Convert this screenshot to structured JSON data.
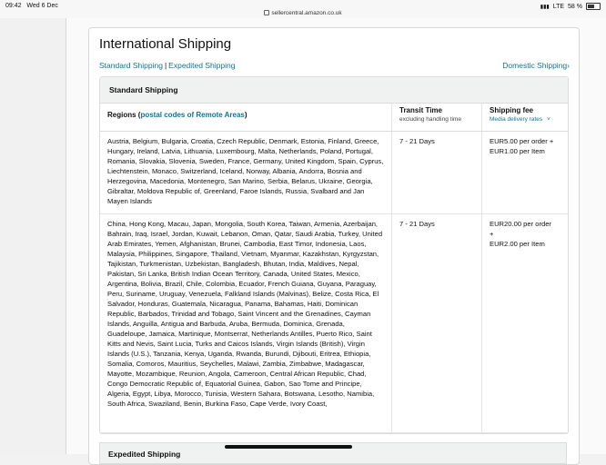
{
  "status_bar": {
    "time": "09:42",
    "date": "Wed 6 Dec",
    "url": "sellercentral.amazon.co.uk",
    "network": "LTE",
    "battery": "58 %",
    "battery_level": 0.58
  },
  "page": {
    "title": "International Shipping",
    "nav": {
      "standard_link": "Standard Shipping",
      "separator": "|",
      "expedited_link": "Expedited Shipping",
      "domestic_link": "Domestic Shipping",
      "domestic_chevron": "›"
    }
  },
  "standard_section": {
    "header": "Standard Shipping",
    "columns": {
      "regions": "Regions",
      "regions_link": "postal codes of Remote Areas",
      "transit": "Transit Time",
      "transit_sub": "excluding handling time",
      "fee": "Shipping fee",
      "fee_sub": "Media delivery rates",
      "fee_chevron": "˅"
    },
    "rows": [
      {
        "regions": "Austria, Belgium, Bulgaria, Croatia, Czech Republic, Denmark, Estonia, Finland, Greece, Hungary, Ireland, Latvia, Lithuania, Luxembourg, Malta, Netherlands, Poland, Portugal, Romania, Slovakia, Slovenia, Sweden, France, Germany, United Kingdom, Spain, Cyprus, Liechtenstein, Monaco, Switzerland, Iceland, Norway, Albania, Andorra, Bosnia and Herzegovina, Macedonia, Montenegro, San Marino, Serbia, Belarus, Ukraine, Georgia, Gibraltar, Moldova Republic of, Greenland, Faroe Islands, Russia, Svalbard and Jan Mayen Islands",
        "transit": "7 - 21 Days",
        "fee_line1": "EUR5.00 per order +",
        "fee_line2": "EUR1.00 per Item"
      },
      {
        "regions": "China, Hong Kong, Macau, Japan, Mongolia, South Korea, Taiwan, Armenia, Azerbaijan, Bahrain, Iraq, Israel, Jordan, Kuwait, Lebanon, Oman, Qatar, Saudi Arabia, Turkey, United Arab Emirates, Yemen, Afghanistan, Brunei, Cambodia, East Timor, Indonesia, Laos, Malaysia, Philippines, Singapore, Thailand, Vietnam, Myanmar, Kazakhstan, Kyrgyzstan, Tajikistan, Turkmenistan, Uzbekistan, Bangladesh, Bhutan, India, Maldives, Nepal, Pakistan, Sri Lanka, British Indian Ocean Territory, Canada, United States, Mexico, Argentina, Bolivia, Brazil, Chile, Colombia, Ecuador, French Guiana, Guyana, Paraguay, Peru, Suriname, Uruguay, Venezuela, Falkland Islands (Malvinas), Belize, Costa Rica, El Salvador, Honduras, Guatemala, Nicaragua, Panama, Bahamas, Haiti, Dominican Republic, Barbados, Trinidad and Tobago, Saint Vincent and the Grenadines, Cayman Islands, Anguilla, Antigua and Barbuda, Aruba, Bermuda, Dominica, Grenada, Guadeloupe, Jamaica, Martinique, Montserrat, Netherlands Antilles, Puerto Rico, Saint Kitts and Nevis, Saint Lucia, Turks and Caicos Islands, Virgin Islands (British), Virgin Islands (U.S.), Tanzania, Kenya, Uganda, Rwanda, Burundi, Djibouti, Eritrea, Ethiopia, Somalia, Comoros, Mauritius, Seychelles, Malawi, Zambia, Zimbabwe, Madagascar, Mayotte, Mozambique, Reunion, Angola, Cameroon, Central African Republic, Chad, Congo Democratic Republic of, Equatorial Guinea, Gabon, Sao Tome and Principe, Algeria, Egypt, Libya, Morocco, Tunisia, Western Sahara, Botswana, Lesotho, Namibia, South Africa, Swaziland, Benin, Burkina Faso, Cape Verde, Ivory Coast,",
        "transit": "7 - 21 Days",
        "fee_line1": "EUR20.00 per order",
        "fee_line2": "+",
        "fee_line3": "EUR2.00 per Item"
      }
    ]
  },
  "expedited_section": {
    "header": "Expedited Shipping"
  }
}
